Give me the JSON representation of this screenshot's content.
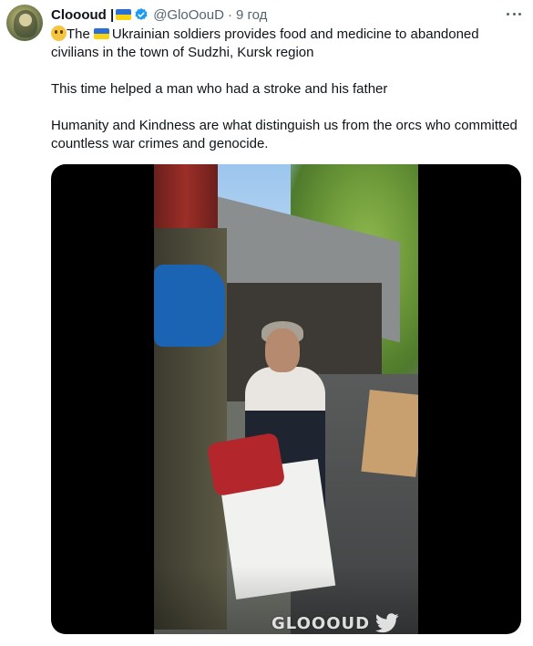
{
  "author": {
    "display_name": "Cloooud |",
    "handle": "@GloOouD",
    "separator": "·",
    "time": "9 год"
  },
  "tweet": {
    "line1_part1": "The",
    "line1_part2": "Ukrainian soldiers provides food and medicine to abandoned",
    "line2": "civilians in the town of Sudzhi, Kursk region",
    "line3": "This time helped a man who had a stroke and his father",
    "line4": "Humanity and Kindness are what distinguish us from the orcs who committed",
    "line5": "countless war crimes and genocide."
  },
  "media": {
    "watermark": "GLOOOUD"
  },
  "icons": {
    "flag": "ukraine-flag-icon",
    "verified": "verified-badge-icon",
    "more": "more-options-icon",
    "emoji": "pleading-face-emoji-icon",
    "bird": "twitter-bird-icon"
  },
  "colors": {
    "text": "#0f1419",
    "secondary": "#536471",
    "verified_blue": "#1d9bf0",
    "flag_blue": "#2a6fd6",
    "flag_yellow": "#f8d30f"
  }
}
